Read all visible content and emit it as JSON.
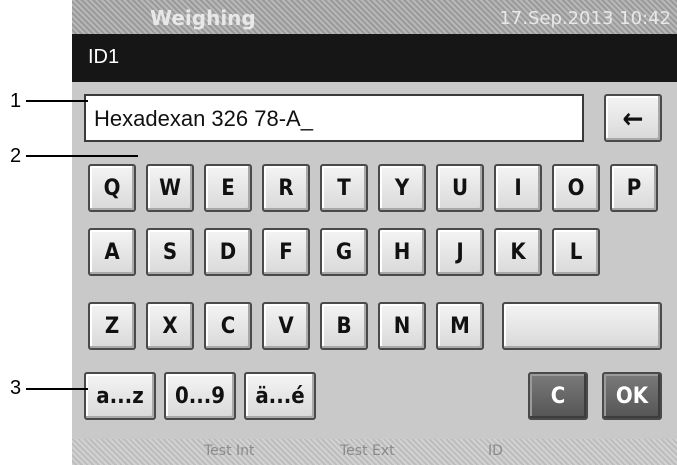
{
  "status_bar": {
    "title": "Weighing",
    "clock": "17.Sep.2013  10:42"
  },
  "header": {
    "field_id": "ID1"
  },
  "input": {
    "value": "Hexadexan 326 78-A_"
  },
  "keys": {
    "row1": [
      "Q",
      "W",
      "E",
      "R",
      "T",
      "Y",
      "U",
      "I",
      "O",
      "P"
    ],
    "row2": [
      "A",
      "S",
      "D",
      "F",
      "G",
      "H",
      "J",
      "K",
      "L"
    ],
    "row3": [
      "Z",
      "X",
      "C",
      "V",
      "B",
      "N",
      "M"
    ],
    "mode_lower": "a...z",
    "mode_digits": "0...9",
    "mode_special": "ä...é",
    "clear": "C",
    "ok": "OK",
    "backspace": "←"
  },
  "footer": {
    "items": [
      "Test Int",
      "Test Ext",
      "ID"
    ]
  },
  "callouts": [
    "1",
    "2",
    "3"
  ]
}
